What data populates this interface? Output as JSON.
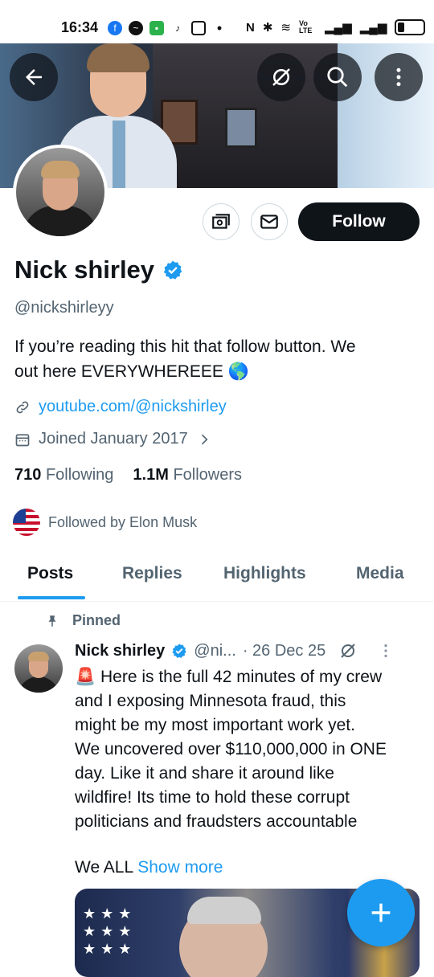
{
  "status_bar": {
    "time": "16:34",
    "network": "Vo LTE"
  },
  "header": {
    "back_icon": "back-arrow-icon",
    "grok_icon": "grok-icon",
    "search_icon": "search-icon",
    "more_icon": "more-vertical-icon"
  },
  "profile": {
    "follow_label": "Follow",
    "name": "Nick shirley",
    "handle": "@nickshirleyy",
    "bio_line1": "If you’re reading this hit that follow button. We",
    "bio_line2": "out here EVERYWHEREEE 🌎",
    "link": "youtube.com/@nickshirley",
    "joined": "Joined January 2017",
    "following_count": "710",
    "following_label": "Following",
    "followers_count": "1.1M",
    "followers_label": "Followers",
    "followed_by": "Followed by Elon Musk"
  },
  "tabs": [
    {
      "label": "Posts",
      "active": true
    },
    {
      "label": "Replies",
      "active": false
    },
    {
      "label": "Highlights",
      "active": false
    },
    {
      "label": "Media",
      "active": false
    }
  ],
  "post": {
    "pinned_label": "Pinned",
    "author": "Nick shirley",
    "handle": "@ni...",
    "date": "· 26 Dec 25",
    "line1": "🚨 Here is the full 42 minutes of my crew",
    "line2": "and I exposing Minnesota fraud, this",
    "line3": "might be my most important work yet.",
    "line4": "We uncovered over $110,000,000 in ONE",
    "line5": "day. Like it and share it around like",
    "line6": "wildfire! Its time to hold these corrupt",
    "line7": "politicians and fraudsters accountable",
    "line8": "We ALL",
    "show_more": "Show more"
  },
  "colors": {
    "accent": "#1d9bf0",
    "text": "#0f1419",
    "secondary": "#536471"
  }
}
